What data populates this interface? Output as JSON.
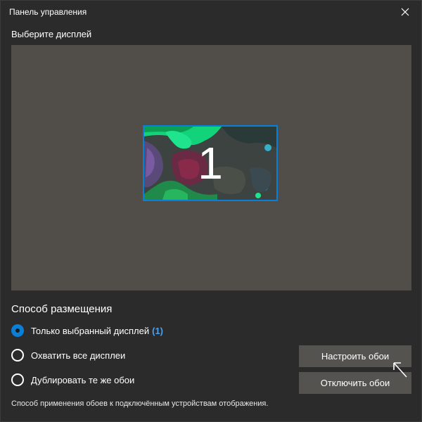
{
  "window": {
    "title": "Панель управления",
    "close_icon": "close-icon"
  },
  "display_select": {
    "heading": "Выберите дисплей",
    "monitor_number": "1"
  },
  "placement": {
    "title": "Способ размещения",
    "options": [
      {
        "label": "Только выбранный дисплей",
        "suffix": "(1)",
        "checked": true
      },
      {
        "label": "Охватить все дисплеи",
        "checked": false
      },
      {
        "label": "Дублировать те же обои",
        "checked": false
      }
    ]
  },
  "buttons": {
    "configure_label": "Настроить обои",
    "disable_label": "Отключить обои"
  },
  "footnote": "Способ применения обоев к подключённым устройствам отображения.",
  "colors": {
    "accent": "#0a7fd8",
    "background": "#2b2b2b",
    "display_area": "#514d48",
    "button": "#555350"
  }
}
